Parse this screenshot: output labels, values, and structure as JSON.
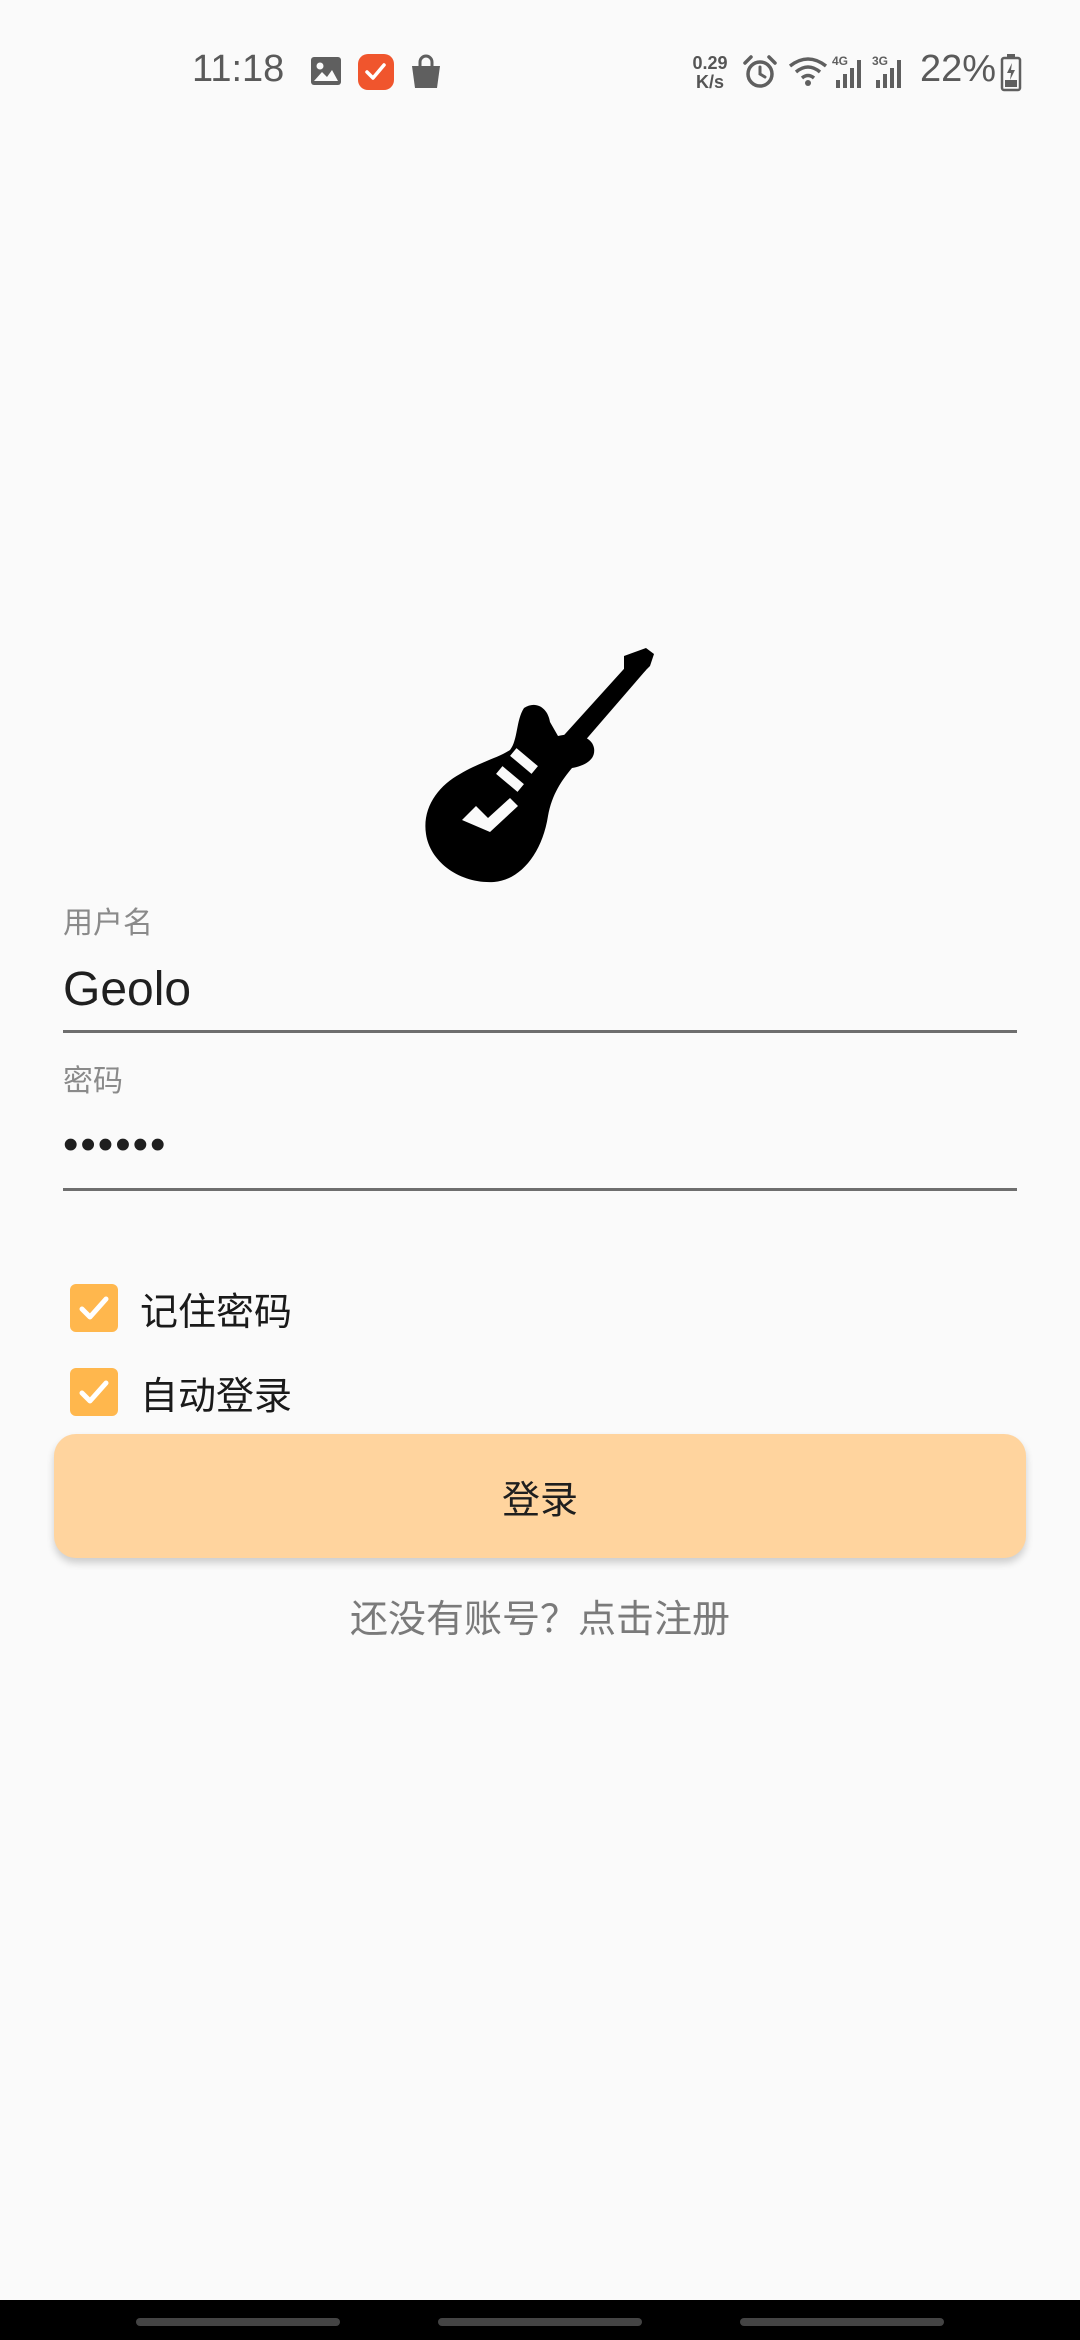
{
  "status_bar": {
    "time": "11:18",
    "net_speed_value": "0.29",
    "net_speed_unit": "K/s",
    "battery_percent": "22%",
    "icons": [
      "image-icon",
      "task-app-icon",
      "shopping-bag-icon",
      "alarm-icon",
      "wifi-icon",
      "signal-4g-icon",
      "signal-3g-icon",
      "battery-icon"
    ]
  },
  "logo": {
    "icon": "electric-guitar-icon"
  },
  "form": {
    "username_label": "用户名",
    "username_value": "Geolo",
    "password_label": "密码",
    "password_value": "••••••"
  },
  "options": {
    "remember_password": {
      "label": "记住密码",
      "checked": true
    },
    "auto_login": {
      "label": "自动登录",
      "checked": true
    }
  },
  "actions": {
    "login_label": "登录",
    "register_prompt": "还没有账号？点击注册"
  },
  "colors": {
    "accent": "#ffb74d",
    "button_bg": "#ffd49e",
    "background": "#fafafa",
    "task_icon": "#f0552d"
  }
}
